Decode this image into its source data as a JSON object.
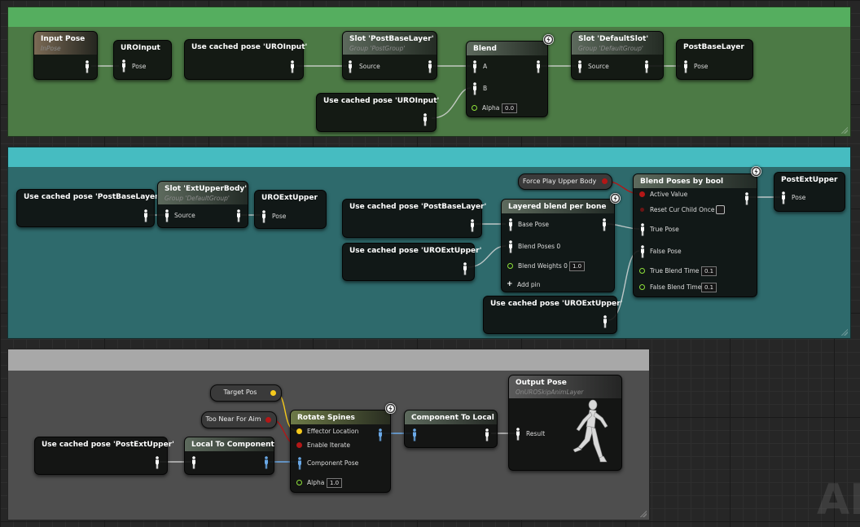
{
  "colors": {
    "comment_green_bg": "#4c7a45",
    "comment_green_bar": "#55ae5f",
    "comment_teal_bg": "#2e6a6c",
    "comment_teal_bar": "#46bcc1",
    "comment_gray_bg": "#4e4e4e",
    "comment_gray_bar": "#a8a8a8",
    "pose_pin": "#ffffff",
    "float_pin": "#8fe23a",
    "bool_pin": "#b31717",
    "vector_pin": "#f5c91c",
    "component_pin": "#6aa9e8"
  },
  "icons": {
    "pose_pin": "person-figure-icon",
    "float_pin": "ring-icon",
    "bool_pin": "dot-icon",
    "fast_path": "lightning-icon",
    "mannequin": "running-mannequin-icon"
  },
  "green_group": {
    "input_pose": {
      "title": "Input Pose",
      "subtitle": "InPose"
    },
    "save_uroinput": {
      "title": "UROInput",
      "pin": "Pose"
    },
    "use_uroinput_1": {
      "title": "Use cached pose 'UROInput'"
    },
    "slot_postbase": {
      "title": "Slot 'PostBaseLayer'",
      "subtitle": "Group 'PostGroup'",
      "pin": "Source"
    },
    "use_uroinput_2": {
      "title": "Use cached pose 'UROInput'"
    },
    "blend": {
      "title": "Blend",
      "pin_a": "A",
      "pin_b": "B",
      "alpha_label": "Alpha",
      "alpha_value": "0.0"
    },
    "slot_default": {
      "title": "Slot 'DefaultSlot'",
      "subtitle": "Group 'DefaultGroup'",
      "pin": "Source"
    },
    "save_postbase": {
      "title": "PostBaseLayer",
      "pin": "Pose"
    }
  },
  "teal_group": {
    "use_postbase_1": {
      "title": "Use cached pose 'PostBaseLayer'"
    },
    "slot_extupper": {
      "title": "Slot 'ExtUpperBody'",
      "subtitle": "Group 'DefaultGroup'",
      "pin": "Source"
    },
    "save_uroextupper": {
      "title": "UROExtUpper",
      "pin": "Pose"
    },
    "use_postbase_2": {
      "title": "Use cached pose 'PostBaseLayer'"
    },
    "use_uroextupper_1": {
      "title": "Use cached pose 'UROExtUpper'"
    },
    "layered_blend": {
      "title": "Layered blend per bone",
      "base_pose": "Base Pose",
      "blend_poses": "Blend Poses 0",
      "blend_weights": "Blend Weights 0",
      "blend_weights_value": "1.0",
      "add_pin": "Add pin",
      "add_pin_symbol": "+"
    },
    "force_play": {
      "label": "Force Play Upper Body"
    },
    "blend_bool": {
      "title": "Blend Poses by bool",
      "active_value": "Active Value",
      "reset_child": "Reset Cur Child Once",
      "true_pose": "True Pose",
      "false_pose": "False Pose",
      "true_blend_time": "True Blend Time",
      "true_blend_time_value": "0.1",
      "false_blend_time": "False Blend Time",
      "false_blend_time_value": "0.1"
    },
    "use_uroextupper_2": {
      "title": "Use cached pose 'UROExtUpper'"
    },
    "save_postextupper": {
      "title": "PostExtUpper",
      "pin": "Pose"
    }
  },
  "gray_group": {
    "use_postextupper": {
      "title": "Use cached pose 'PostExtUpper'"
    },
    "local_to_component": {
      "title": "Local To Component"
    },
    "target_pos": {
      "label": "Target Pos"
    },
    "too_near": {
      "label": "Too Near For Aim"
    },
    "rotate_spines": {
      "title": "Rotate Spines",
      "effector_location": "Effector Location",
      "enable_iterate": "Enable Iterate",
      "component_pose": "Component Pose",
      "alpha_label": "Alpha",
      "alpha_value": "1.0"
    },
    "component_to_local": {
      "title": "Component To Local"
    },
    "output_pose": {
      "title": "Output Pose",
      "subtitle": "OnUROSkipAnimLayer",
      "pin": "Result"
    }
  },
  "watermark": "AN"
}
